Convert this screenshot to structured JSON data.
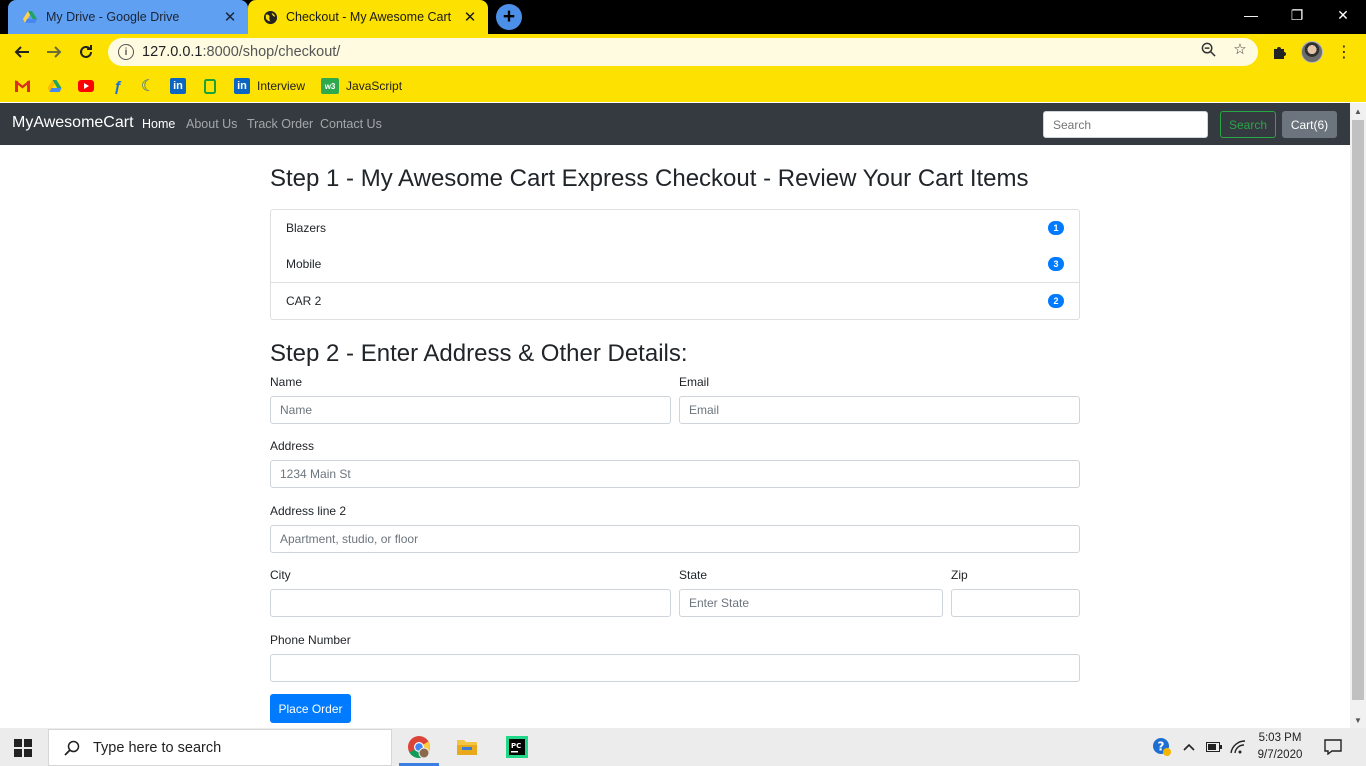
{
  "browser": {
    "tabs": [
      {
        "title": "My Drive - Google Drive",
        "close": "✕"
      },
      {
        "title": "Checkout - My Awesome Cart",
        "close": "✕"
      }
    ],
    "newtab": "+",
    "window_controls": {
      "minimize": "—",
      "maximize": "❐",
      "close": "✕"
    },
    "url_host": "127.0.0.1",
    "url_path": ":8000/shop/checkout/",
    "bookmarks": [
      {
        "icon": "gmail-icon",
        "label": ""
      },
      {
        "icon": "google-drive-icon",
        "label": ""
      },
      {
        "icon": "youtube-icon",
        "label": ""
      },
      {
        "icon": "f-icon",
        "label": ""
      },
      {
        "icon": "crescent-icon",
        "label": ""
      },
      {
        "icon": "linkedin-icon",
        "label": ""
      },
      {
        "icon": "phone-icon",
        "label": ""
      },
      {
        "icon": "linkedin-icon",
        "label": "Interview"
      },
      {
        "icon": "w3schools-icon",
        "label": "JavaScript"
      }
    ]
  },
  "site": {
    "brand": "MyAwesomeCart",
    "nav": [
      "Home",
      "About Us",
      "Track Order",
      "Contact Us"
    ],
    "search_placeholder": "Search",
    "search_button": "Search",
    "cart_button": "Cart(6)"
  },
  "checkout": {
    "step1_title": "Step 1 - My Awesome Cart Express Checkout - Review Your Cart Items",
    "cart_items": [
      {
        "name": "Blazers",
        "qty": "1"
      },
      {
        "name": "Mobile",
        "qty": "3"
      },
      {
        "name": "CAR 2",
        "qty": "2"
      }
    ],
    "step2_title": "Step 2 - Enter Address & Other Details:",
    "form": {
      "name_label": "Name",
      "name_placeholder": "Name",
      "email_label": "Email",
      "email_placeholder": "Email",
      "address_label": "Address",
      "address_placeholder": "1234 Main St",
      "address2_label": "Address line 2",
      "address2_placeholder": "Apartment, studio, or floor",
      "city_label": "City",
      "city_placeholder": "",
      "state_label": "State",
      "state_placeholder": "Enter State",
      "zip_label": "Zip",
      "zip_placeholder": "",
      "phone_label": "Phone Number",
      "phone_placeholder": ""
    },
    "submit": "Place Order"
  },
  "taskbar": {
    "search_text": "Type here to search",
    "time": "5:03 PM",
    "date": "9/7/2020"
  },
  "colors": {
    "chrome_theme": "#fde100",
    "navbar": "#343a40",
    "primary": "#007bff",
    "success": "#28a745",
    "secondary": "#6c757d"
  }
}
